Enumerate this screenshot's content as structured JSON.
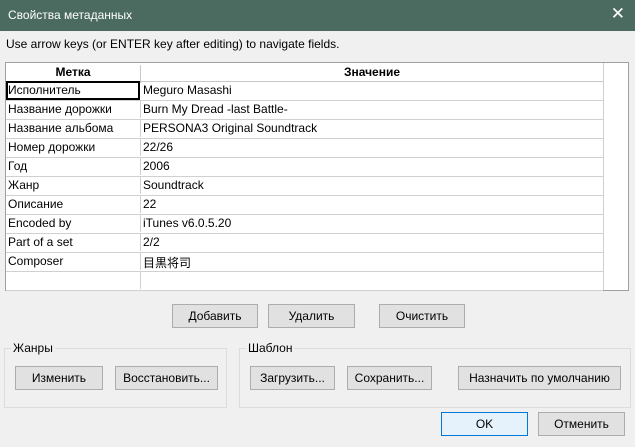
{
  "window": {
    "title": "Свойства метаданных",
    "close_icon": "close-icon"
  },
  "hint": "Use arrow keys (or ENTER key after editing) to navigate fields.",
  "table": {
    "headers": [
      "Метка",
      "Значение"
    ],
    "rows": [
      {
        "label": "Исполнитель",
        "value": "Meguro Masashi"
      },
      {
        "label": "Название дорожки",
        "value": "Burn My Dread -last Battle-"
      },
      {
        "label": "Название альбома",
        "value": "PERSONA3 Original Soundtrack"
      },
      {
        "label": "Номер дорожки",
        "value": "22/26"
      },
      {
        "label": "Год",
        "value": "2006"
      },
      {
        "label": "Жанр",
        "value": "Soundtrack"
      },
      {
        "label": "Описание",
        "value": "22"
      },
      {
        "label": "Encoded by",
        "value": "iTunes v6.0.5.20"
      },
      {
        "label": "Part of a set",
        "value": "2/2"
      },
      {
        "label": "Composer",
        "value": "目黒将司"
      }
    ]
  },
  "buttons": {
    "add": "Добавить",
    "delete": "Удалить",
    "clear": "Очистить"
  },
  "genres": {
    "title": "Жанры",
    "edit": "Изменить",
    "restore": "Восстановить..."
  },
  "template": {
    "title": "Шаблон",
    "load": "Загрузить...",
    "save": "Сохранить...",
    "set_default": "Назначить по умолчанию"
  },
  "footer": {
    "ok": "OK",
    "cancel": "Отменить"
  }
}
